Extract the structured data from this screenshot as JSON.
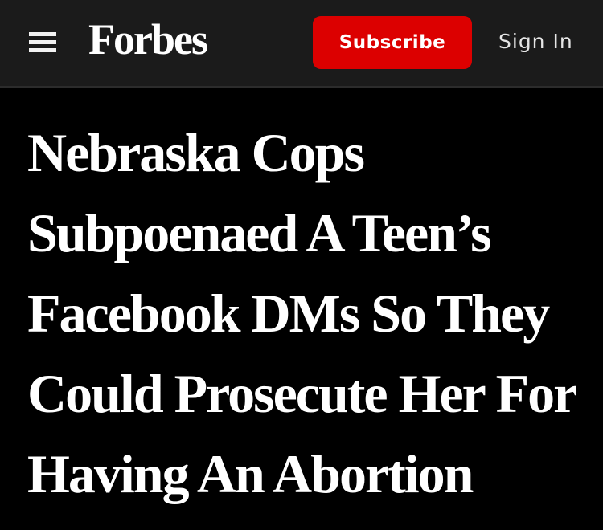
{
  "header": {
    "menu_icon": "hamburger-menu-icon",
    "logo_text": "Forbes",
    "subscribe_label": "Subscribe",
    "signin_label": "Sign In",
    "colors": {
      "header_bg": "#1b1b1b",
      "subscribe_bg": "#dc0000",
      "page_bg": "#000000",
      "text": "#ffffff"
    }
  },
  "article": {
    "headline": "Nebraska Cops Subpoenaed A Teen’s Facebook DMs So They Could Prosecute Her For Having An Abortion"
  }
}
